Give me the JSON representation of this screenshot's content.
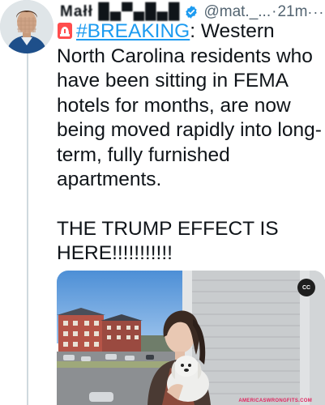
{
  "tweet": {
    "author": {
      "display_name": "Małł █▄▀▄█▄█",
      "handle": "@mat._...",
      "time": "21m",
      "verified_icon": "verified-badge-icon",
      "verified_color": "#1d9bf0"
    },
    "more_label": "···",
    "body": {
      "emoji": "siren-icon",
      "hashtag": "#BREAKING",
      "text_after_hashtag": ": Western North Carolina residents who have been sitting in FEMA hotels for months, are now being moved rapidly into long-term, fully furnished apartments.",
      "text_second_paragraph": "THE TRUMP EFFECT IS HERE!!!!!!!!!!!"
    },
    "media": {
      "type": "video",
      "captions_badge": "CC"
    }
  },
  "watermark": "AMERICASWRONGFITS.COM",
  "colors": {
    "link": "#1d9bf0",
    "secondary_text": "#536471",
    "thread_line": "#cfd9de"
  }
}
